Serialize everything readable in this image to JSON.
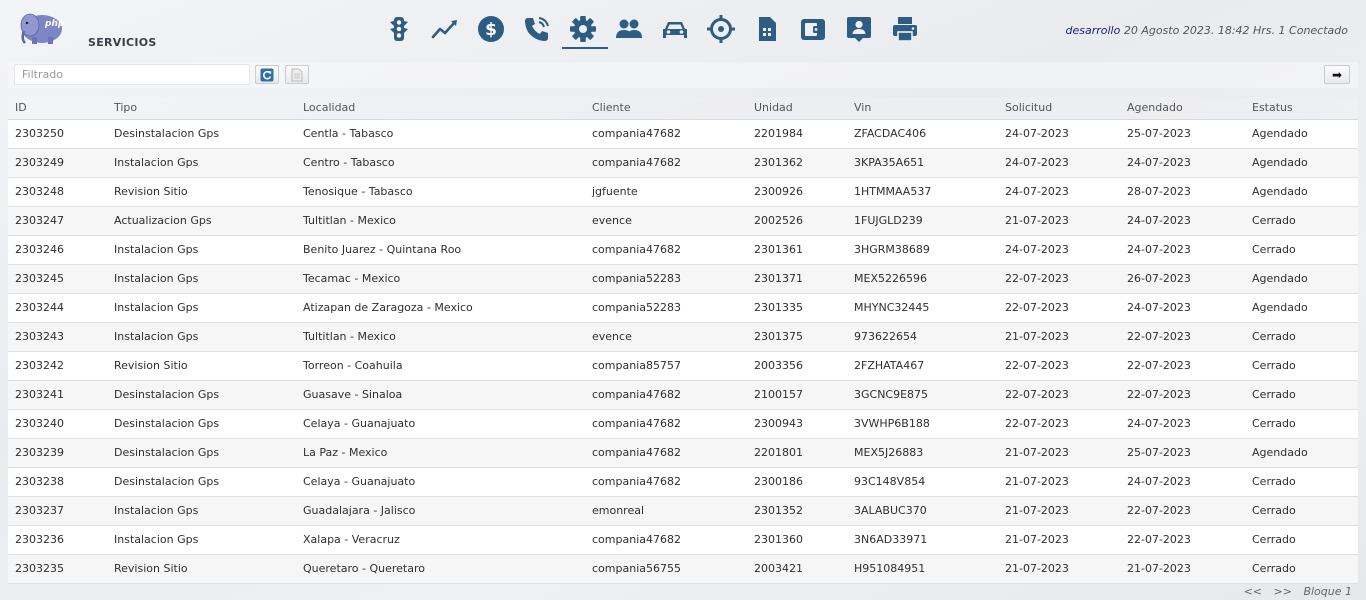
{
  "header": {
    "page_title": "SERVICIOS",
    "user": "desarrollo",
    "session_info": "20 Agosto 2023. 18:42 Hrs. 1 Conectado",
    "logo_text": "php",
    "nav": [
      {
        "icon": "traffic-light-icon"
      },
      {
        "icon": "line-chart-icon"
      },
      {
        "icon": "dollar-icon"
      },
      {
        "icon": "phone-icon"
      },
      {
        "icon": "gear-icon",
        "active": true
      },
      {
        "icon": "users-icon"
      },
      {
        "icon": "car-icon"
      },
      {
        "icon": "crosshairs-icon"
      },
      {
        "icon": "sim-card-icon"
      },
      {
        "icon": "wallet-icon"
      },
      {
        "icon": "user-badge-icon"
      },
      {
        "icon": "printer-icon"
      }
    ]
  },
  "toolbar": {
    "filter_placeholder": "Filtrado",
    "next_label": "➡"
  },
  "table": {
    "columns": [
      "ID",
      "Tipo",
      "Localidad",
      "Cliente",
      "Unidad",
      "Vin",
      "Solicitud",
      "Agendado",
      "Estatus"
    ],
    "rows": [
      [
        "2303250",
        "Desinstalacion Gps",
        "Centla - Tabasco",
        "compania47682",
        "2201984",
        "ZFACDAC406",
        "24-07-2023",
        "25-07-2023",
        "Agendado"
      ],
      [
        "2303249",
        "Instalacion Gps",
        "Centro - Tabasco",
        "compania47682",
        "2301362",
        "3KPA35A651",
        "24-07-2023",
        "24-07-2023",
        "Agendado"
      ],
      [
        "2303248",
        "Revision Sitio",
        "Tenosique - Tabasco",
        "jgfuente",
        "2300926",
        "1HTMMAA537",
        "24-07-2023",
        "28-07-2023",
        "Agendado"
      ],
      [
        "2303247",
        "Actualizacion Gps",
        "Tultitlan - Mexico",
        "evence",
        "2002526",
        "1FUJGLD239",
        "21-07-2023",
        "24-07-2023",
        "Cerrado"
      ],
      [
        "2303246",
        "Instalacion Gps",
        "Benito Juarez - Quintana Roo",
        "compania47682",
        "2301361",
        "3HGRM38689",
        "24-07-2023",
        "24-07-2023",
        "Cerrado"
      ],
      [
        "2303245",
        "Instalacion Gps",
        "Tecamac - Mexico",
        "compania52283",
        "2301371",
        "MEX5226596",
        "22-07-2023",
        "26-07-2023",
        "Agendado"
      ],
      [
        "2303244",
        "Instalacion Gps",
        "Atizapan de Zaragoza - Mexico",
        "compania52283",
        "2301335",
        "MHYNC32445",
        "22-07-2023",
        "24-07-2023",
        "Agendado"
      ],
      [
        "2303243",
        "Instalacion Gps",
        "Tultitlan - Mexico",
        "evence",
        "2301375",
        "973622654",
        "21-07-2023",
        "22-07-2023",
        "Cerrado"
      ],
      [
        "2303242",
        "Revision Sitio",
        "Torreon - Coahuila",
        "compania85757",
        "2003356",
        "2FZHATA467",
        "22-07-2023",
        "22-07-2023",
        "Cerrado"
      ],
      [
        "2303241",
        "Desinstalacion Gps",
        "Guasave - Sinaloa",
        "compania47682",
        "2100157",
        "3GCNC9E875",
        "22-07-2023",
        "22-07-2023",
        "Cerrado"
      ],
      [
        "2303240",
        "Desinstalacion Gps",
        "Celaya - Guanajuato",
        "compania47682",
        "2300943",
        "3VWHP6B188",
        "22-07-2023",
        "24-07-2023",
        "Cerrado"
      ],
      [
        "2303239",
        "Desinstalacion Gps",
        "La Paz - Mexico",
        "compania47682",
        "2201801",
        "MEX5J26883",
        "21-07-2023",
        "25-07-2023",
        "Agendado"
      ],
      [
        "2303238",
        "Desinstalacion Gps",
        "Celaya - Guanajuato",
        "compania47682",
        "2300186",
        "93C148V854",
        "21-07-2023",
        "24-07-2023",
        "Cerrado"
      ],
      [
        "2303237",
        "Instalacion Gps",
        "Guadalajara - Jalisco",
        "emonreal",
        "2301352",
        "3ALABUC370",
        "21-07-2023",
        "22-07-2023",
        "Cerrado"
      ],
      [
        "2303236",
        "Instalacion Gps",
        "Xalapa - Veracruz",
        "compania47682",
        "2301360",
        "3N6AD33971",
        "21-07-2023",
        "22-07-2023",
        "Cerrado"
      ],
      [
        "2303235",
        "Revision Sitio",
        "Queretaro - Queretaro",
        "compania56755",
        "2003421",
        "H951084951",
        "21-07-2023",
        "21-07-2023",
        "Cerrado"
      ]
    ]
  },
  "pager": {
    "prev": "<<",
    "next": ">>",
    "label": "Bloque 1"
  },
  "colors": {
    "icon": "#2e5d83",
    "user_name": "#1a237e"
  }
}
